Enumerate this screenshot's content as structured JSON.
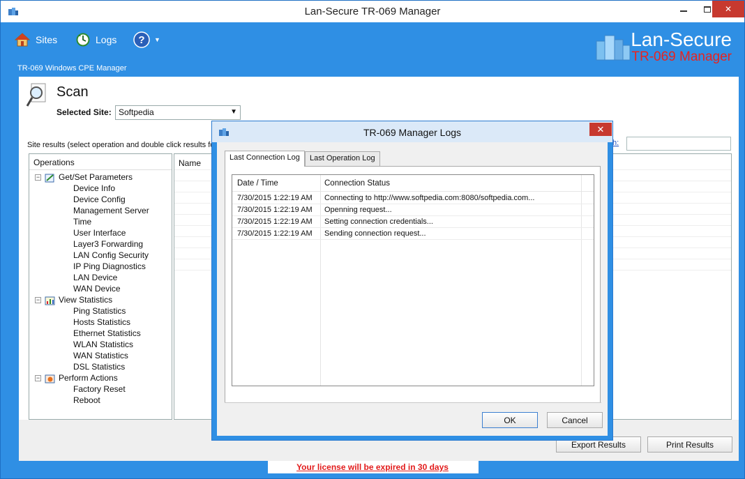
{
  "window": {
    "title": "Lan-Secure TR-069 Manager"
  },
  "toolbar": {
    "sites_label": "Sites",
    "logs_label": "Logs"
  },
  "brand": {
    "line1": "Lan-Secure",
    "line2": "TR-069 Manager",
    "accent_color": "#e8231f"
  },
  "subtitle": "TR-069 Windows CPE Manager",
  "scan": {
    "title": "Scan",
    "site_label": "Selected Site:",
    "site_value": "Softpedia",
    "results_label": "Site results (select operation and double click results for",
    "search_link": "h:"
  },
  "tree": {
    "header": "Operations",
    "groups": [
      {
        "label": "Get/Set Parameters",
        "expander": "−",
        "items": [
          "Device Info",
          "Device Config",
          "Management Server",
          "Time",
          "User Interface",
          "Layer3 Forwarding",
          "LAN Config Security",
          "IP Ping Diagnostics",
          "LAN Device",
          "WAN Device"
        ]
      },
      {
        "label": "View Statistics",
        "expander": "−",
        "items": [
          "Ping Statistics",
          "Hosts Statistics",
          "Ethernet Statistics",
          "WLAN Statistics",
          "WAN Statistics",
          "DSL Statistics"
        ]
      },
      {
        "label": "Perform Actions",
        "expander": "−",
        "items": [
          "Factory Reset",
          "Reboot"
        ]
      }
    ]
  },
  "results": {
    "col_name": "Name"
  },
  "buttons": {
    "export": "Export Results",
    "print": "Print Results"
  },
  "license": "Your license will be expired in 30 days",
  "dialog": {
    "title": "TR-069 Manager Logs",
    "tabs": [
      "Last Connection Log",
      "Last Operation Log"
    ],
    "columns": [
      "Date / Time",
      "Connection Status"
    ],
    "rows": [
      {
        "time": "7/30/2015 1:22:19 AM",
        "status": "Connecting to http://www.softpedia.com:8080/softpedia.com..."
      },
      {
        "time": "7/30/2015 1:22:19 AM",
        "status": "Openning request..."
      },
      {
        "time": "7/30/2015 1:22:19 AM",
        "status": "Setting connection credentials..."
      },
      {
        "time": "7/30/2015 1:22:19 AM",
        "status": "Sending connection request..."
      }
    ],
    "ok_label": "OK",
    "cancel_label": "Cancel",
    "close_glyph": "✕"
  }
}
